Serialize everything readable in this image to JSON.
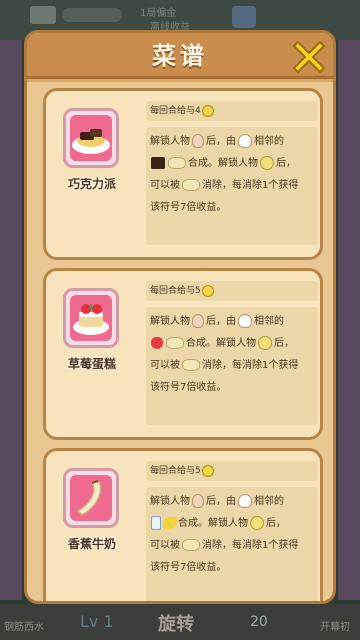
{
  "background": {
    "top_line1": "1局偏金",
    "top_line2": "离线收益"
  },
  "bottom_bar": {
    "item1": "钢筋西水",
    "level": "Lv 1",
    "spin": "旋转",
    "count": "20",
    "item5": "开幕初"
  },
  "panel": {
    "title": "菜谱",
    "close_icon": "close-x-icon"
  },
  "recipes": [
    {
      "name": "巧克力派",
      "reward": "每回合给与4",
      "line1_a": "解锁人物",
      "line1_b": "后，由",
      "line1_c": "相邻的",
      "line2": "合成。解锁人物",
      "line2_b": "后，",
      "line3_a": "可以被",
      "line3_b": "消除，每消除1个获得",
      "line4": "该符号7倍收益。",
      "icon": "chocolate-pie-icon",
      "ingredient1": "chocolate-icon",
      "ingredient2": "cream-icon"
    },
    {
      "name": "草莓蛋糕",
      "reward": "每回合给与5",
      "line1_a": "解锁人物",
      "line1_b": "后，由",
      "line1_c": "相邻的",
      "line2": "合成。解锁人物",
      "line2_b": "后，",
      "line3_a": "可以被",
      "line3_b": "消除，每消除1个获得",
      "line4": "该符号7倍收益。",
      "icon": "strawberry-cake-icon",
      "ingredient1": "strawberry-icon",
      "ingredient2": "flour-icon"
    },
    {
      "name": "香蕉牛奶",
      "reward": "每回合给与5",
      "line1_a": "解锁人物",
      "line1_b": "后，由",
      "line1_c": "相邻的",
      "line2": "合成。解锁人物",
      "line2_b": "后，",
      "line3_a": "可以被",
      "line3_b": "消除，每消除1个获得",
      "line4": "该符号7倍收益。",
      "icon": "banana-milk-icon",
      "ingredient1": "milk-icon",
      "ingredient2": "banana-icon"
    }
  ]
}
